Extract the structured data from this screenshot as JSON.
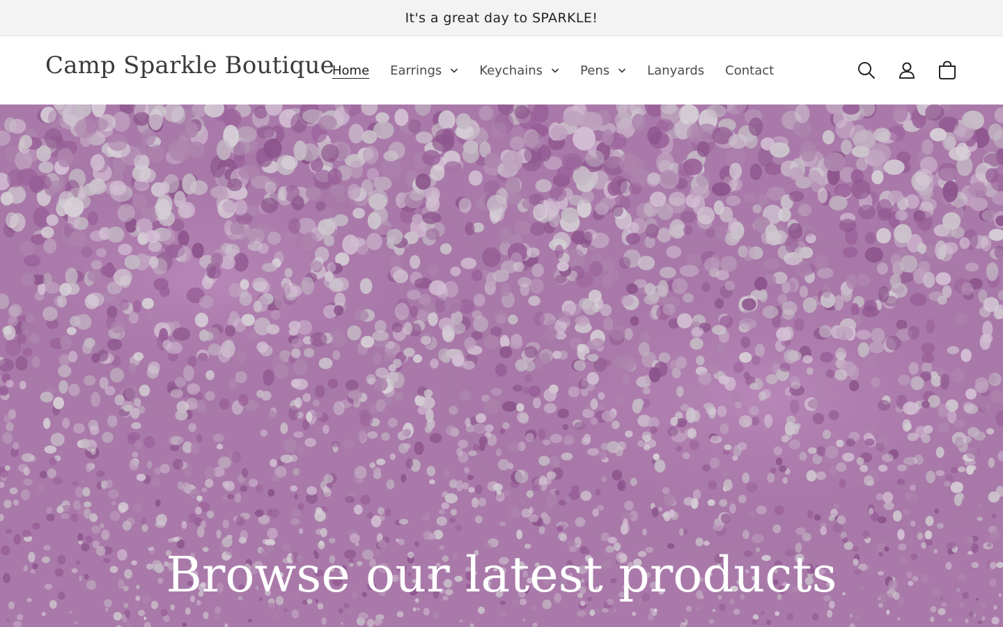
{
  "announcement": {
    "text": "It's a great day to SPARKLE!"
  },
  "header": {
    "logo": "Camp Sparkle Boutique",
    "nav": [
      {
        "label": "Home",
        "active": true,
        "has_dropdown": false
      },
      {
        "label": "Earrings",
        "active": false,
        "has_dropdown": true
      },
      {
        "label": "Keychains",
        "active": false,
        "has_dropdown": true
      },
      {
        "label": "Pens",
        "active": false,
        "has_dropdown": true
      },
      {
        "label": "Lanyards",
        "active": false,
        "has_dropdown": false
      },
      {
        "label": "Contact",
        "active": false,
        "has_dropdown": false
      }
    ],
    "icons": [
      "search-icon",
      "account-icon",
      "cart-icon"
    ]
  },
  "hero": {
    "heading": "Browse our latest products"
  },
  "colors": {
    "announcement_bg": "#f3f3f3",
    "hero_glitter": "#b57db5",
    "text_dark": "#222222"
  }
}
